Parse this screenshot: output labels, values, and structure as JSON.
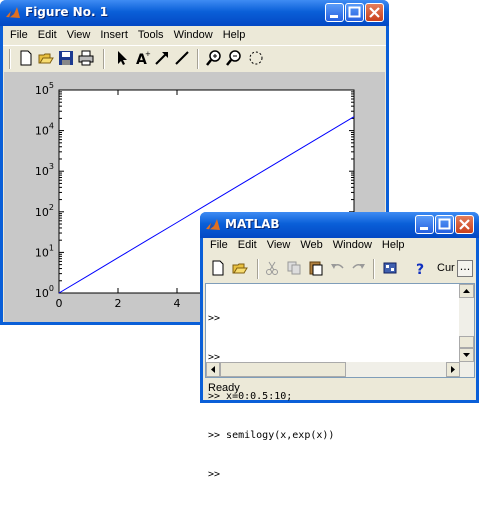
{
  "figure": {
    "title": "Figure No. 1",
    "menu": [
      "File",
      "Edit",
      "View",
      "Insert",
      "Tools",
      "Window",
      "Help"
    ]
  },
  "matlab": {
    "title": "MATLAB",
    "menu": [
      "File",
      "Edit",
      "View",
      "Web",
      "Window",
      "Help"
    ],
    "cur_label": "Cur",
    "more_label": "...",
    "console_lines": [
      ">>",
      ">>",
      ">> x=0:0.5:10;",
      ">> semilogy(x,exp(x))",
      ">>"
    ],
    "status": "Ready"
  },
  "chart_data": {
    "type": "line",
    "yscale": "log",
    "xlim": [
      0,
      10
    ],
    "ylim": [
      1,
      100000
    ],
    "x_ticks": [
      "0",
      "2",
      "4"
    ],
    "y_ticks": [
      {
        "base": "10",
        "exp": "0"
      },
      {
        "base": "10",
        "exp": "1"
      },
      {
        "base": "10",
        "exp": "2"
      },
      {
        "base": "10",
        "exp": "3"
      },
      {
        "base": "10",
        "exp": "4"
      },
      {
        "base": "10",
        "exp": "5"
      }
    ],
    "series": [
      {
        "x": [
          0,
          1,
          2,
          3,
          4,
          5,
          6,
          7,
          8,
          9,
          10
        ],
        "y": [
          1,
          2.718,
          7.389,
          20.09,
          54.6,
          148.4,
          403.4,
          1096.6,
          2981,
          8103,
          22026
        ],
        "color": "#0000ff"
      }
    ]
  },
  "colors": {
    "xp_blue": "#0a5fd8",
    "figure_bg": "#c8c8c8",
    "face": "#ece9d8",
    "line": "#0000ff"
  }
}
